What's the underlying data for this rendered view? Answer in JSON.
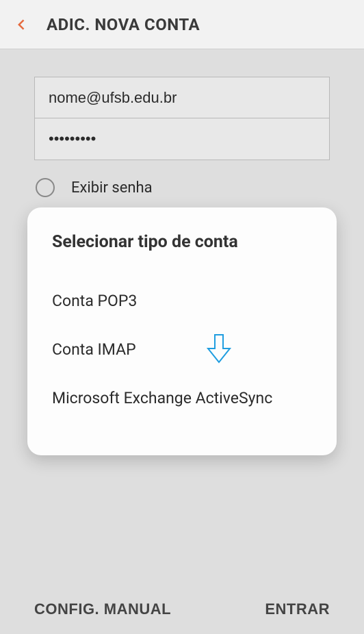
{
  "header": {
    "title": "ADIC. NOVA CONTA"
  },
  "form": {
    "email_value": "nome@ufsb.edu.br",
    "password_value": "•••••••••",
    "show_password_label": "Exibir senha"
  },
  "dialog": {
    "title": "Selecionar tipo de conta",
    "options": {
      "0": "Conta POP3",
      "1": "Conta IMAP",
      "2": "Microsoft Exchange ActiveSync"
    }
  },
  "footer": {
    "manual_config": "CONFIG. MANUAL",
    "enter": "ENTRAR"
  }
}
